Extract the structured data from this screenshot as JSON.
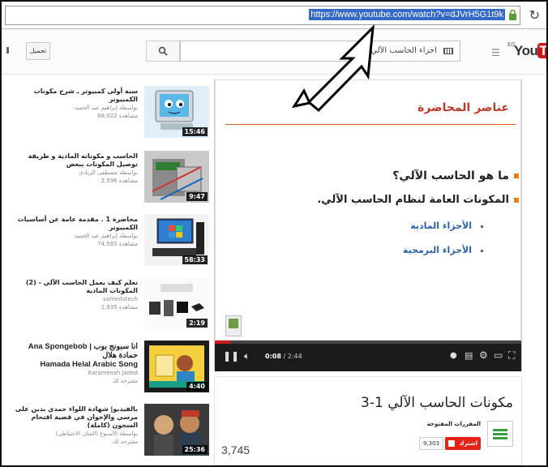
{
  "browser": {
    "url": "https://www.youtube.com/watch?v=dJVrH5G1t9k",
    "reload_icon": "reload-icon",
    "lock_icon": "lock-icon"
  },
  "header": {
    "upload_label": "تحميل",
    "search_value": "اجزاء الحاسب الآلي",
    "logo_prefix": "EG",
    "logo_you": "You",
    "logo_tube": "Tube"
  },
  "related": [
    {
      "title": "سنة أولى كمبيوتر ـ شرح مكونات الكمبيوتر",
      "by": "بواسطة إبراهيم عبد الحميد",
      "views": "68,022 مشاهدة",
      "duration": "15:46"
    },
    {
      "title": "الحاسب و مكوناته المادية و طريقة توصيل المكونات ببعض",
      "by": "بواسطة مصطفى الزيادي",
      "views": "2,596 مشاهدة",
      "duration": "9:47"
    },
    {
      "title": "محاضرة 1 . مقدمة عامة عن أساسيات الكمبيوتر",
      "by": "بواسطة إبراهيم عبد الحميد",
      "views": "74,585 مشاهدة",
      "duration": "58:33"
    },
    {
      "title": "تعلم كيف يعمل الحاسب الآلي - (2) المكونات المادية",
      "by": "sahledutech",
      "views": "1,935 مشاهدة",
      "duration": "2:19"
    },
    {
      "title": "Ana Spongebob | انا سبونج بوب حمادة هلال",
      "title2": "Hamada Helal Arabic Song",
      "by": "Karameesh Jaded",
      "views": "مقترحة لك",
      "duration": "4:40"
    },
    {
      "title": "بالفيديو| شهادة اللواء حمدي بدين على مرسي والإخوان في قضية اقتحام السجون (كاملة)",
      "by": "بواسطة الأسبوع (الفنان الاحتياطي)",
      "views": "مقترحة لك",
      "duration": "25:36"
    }
  ],
  "slide": {
    "title": "عناصر المحاضرة",
    "bullet1": "ما هو الحاسب الآلي؟",
    "bullet2": "المكونات العامة لنظام الحاسب الآلي.",
    "sub1": "الأجزاء المادية",
    "sub2": "الأجزاء البرمجية"
  },
  "player": {
    "current_time": "0:08",
    "total_time": "/ 2:44",
    "progress": 0.05
  },
  "video": {
    "title": "مكونات الحاسب الآلي 1-3",
    "channel": "المقررات المفتوحة",
    "subscribe_label": "اشترك",
    "subscriber_count": "9,303",
    "views": "3,745"
  },
  "colors": {
    "accent_red": "#cc181e",
    "url_highlight": "#3569c8",
    "slide_title": "#c0392b",
    "slide_sub": "#2b5fa8"
  }
}
